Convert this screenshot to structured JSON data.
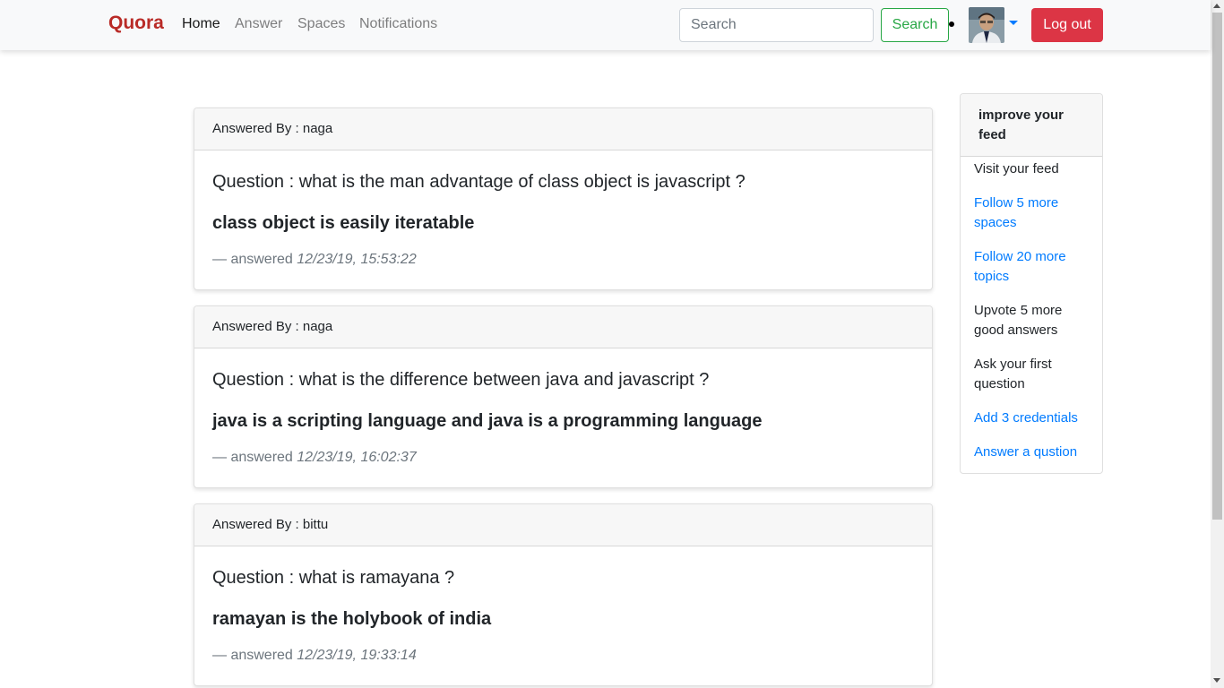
{
  "navbar": {
    "brand": "Quora",
    "links": [
      {
        "label": "Home",
        "active": true
      },
      {
        "label": "Answer",
        "active": false
      },
      {
        "label": "Spaces",
        "active": false
      },
      {
        "label": "Notifications",
        "active": false
      }
    ],
    "search_placeholder": "Search",
    "search_button": "Search",
    "logout_button": "Log out"
  },
  "feed": [
    {
      "answered_by_label": "Answered By : naga",
      "question": "Question : what is the man advantage of class object is javascript ?",
      "answer": "class object is easily iteratable",
      "answered_prefix": "— answered ",
      "timestamp": "12/23/19, 15:53:22"
    },
    {
      "answered_by_label": "Answered By : naga",
      "question": "Question : what is the difference between java and javascript ?",
      "answer": "java is a scripting language and java is a programming language",
      "answered_prefix": "— answered ",
      "timestamp": "12/23/19, 16:02:37"
    },
    {
      "answered_by_label": "Answered By : bittu",
      "question": "Question : what is ramayana ?",
      "answer": "ramayan is the holybook of india",
      "answered_prefix": "— answered ",
      "timestamp": "12/23/19, 19:33:14"
    }
  ],
  "sidebar": {
    "title": "improve your feed",
    "items": [
      {
        "label": "Visit your feed",
        "link": false
      },
      {
        "label": "Follow 5 more spaces",
        "link": true
      },
      {
        "label": "Follow 20 more topics",
        "link": true
      },
      {
        "label": "Upvote 5 more good answers",
        "link": false
      },
      {
        "label": "Ask your first question",
        "link": false
      },
      {
        "label": "Add 3 credentials",
        "link": true
      },
      {
        "label": "Answer a qustion",
        "link": true
      }
    ]
  },
  "colors": {
    "brand": "#b92b27",
    "success": "#28a745",
    "danger": "#dc3545",
    "link": "#007bff"
  }
}
